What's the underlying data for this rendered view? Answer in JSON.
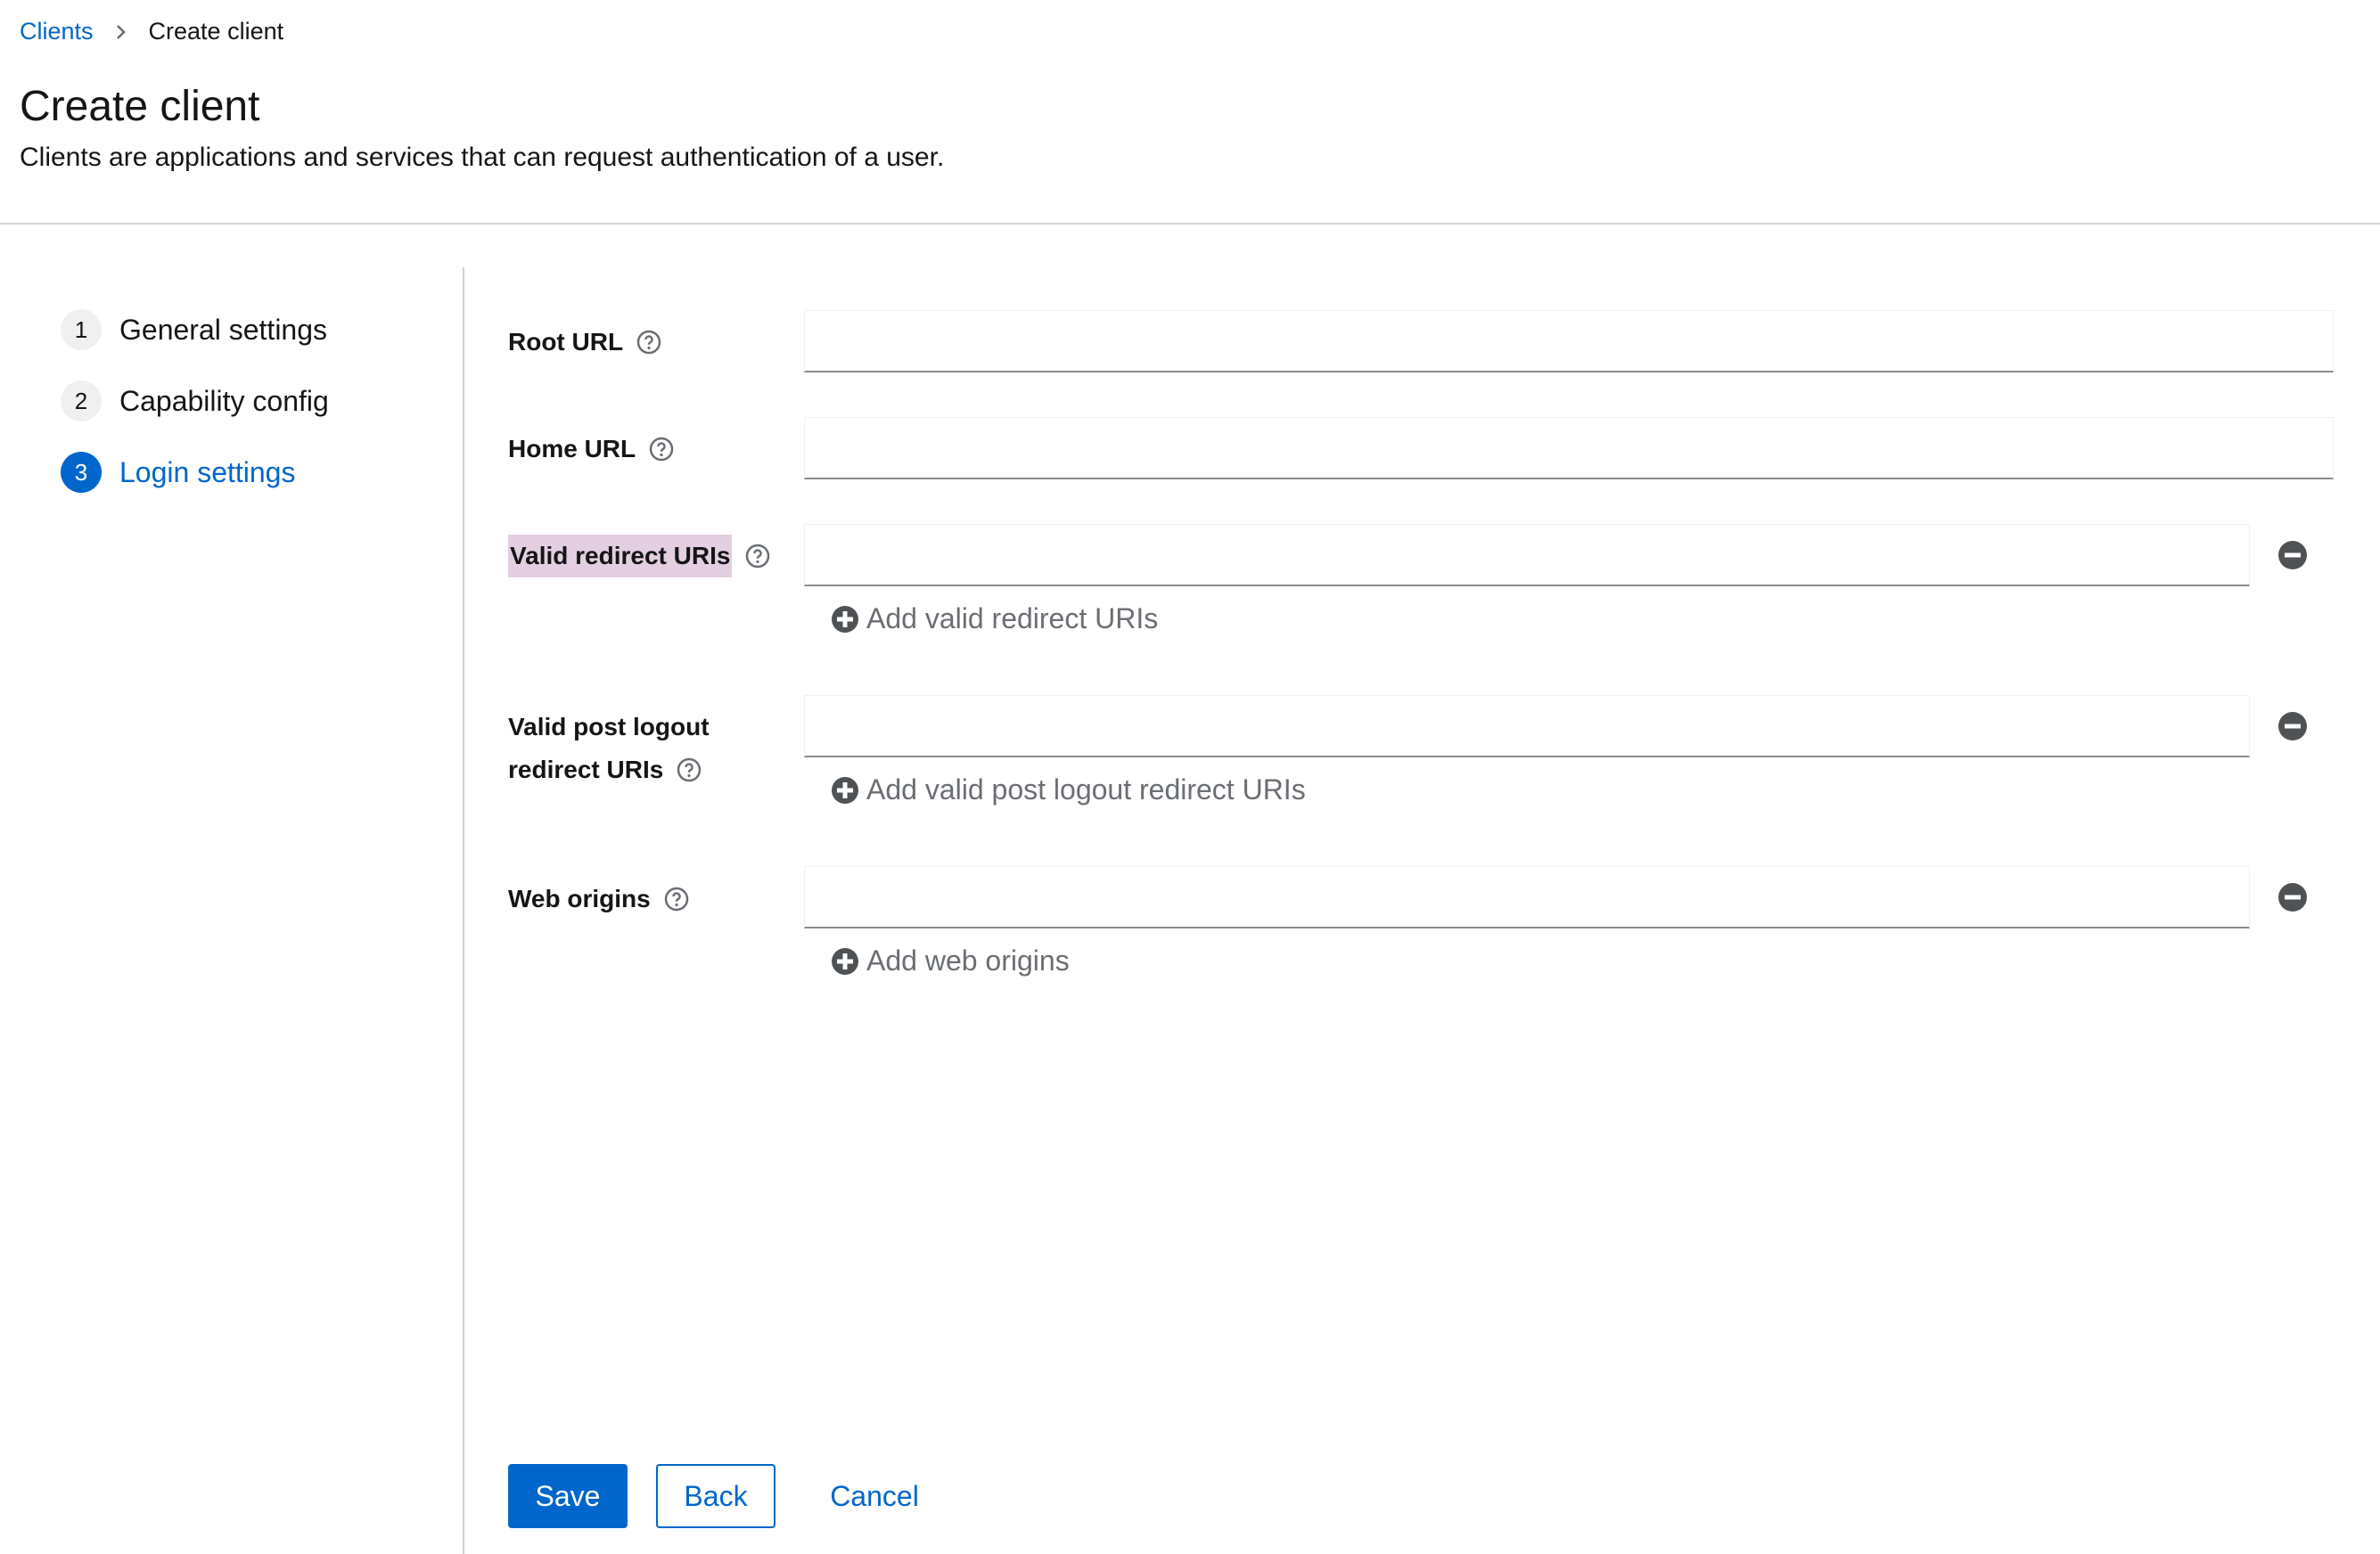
{
  "breadcrumb": {
    "parent": "Clients",
    "current": "Create client"
  },
  "header": {
    "title": "Create client",
    "description": "Clients are applications and services that can request authentication of a user."
  },
  "wizard": {
    "steps": [
      {
        "number": "1",
        "label": "General settings"
      },
      {
        "number": "2",
        "label": "Capability config"
      },
      {
        "number": "3",
        "label": "Login settings"
      }
    ],
    "current_step": 3
  },
  "form": {
    "root_url": {
      "label": "Root URL",
      "value": ""
    },
    "home_url": {
      "label": "Home URL",
      "value": ""
    },
    "valid_redirect_uris": {
      "label": "Valid redirect URIs",
      "value": "",
      "add_label": "Add valid redirect URIs"
    },
    "valid_post_logout_redirect_uris": {
      "label_line1": "Valid post logout",
      "label_line2": "redirect URIs",
      "value": "",
      "add_label": "Add valid post logout redirect URIs"
    },
    "web_origins": {
      "label": "Web origins",
      "value": "",
      "add_label": "Add web origins"
    }
  },
  "actions": {
    "save": "Save",
    "back": "Back",
    "cancel": "Cancel"
  },
  "colors": {
    "primary": "#0066cc",
    "highlight": "#e3cfe1",
    "border": "#d2d2d2",
    "muted": "#6a6e73"
  },
  "icons": {
    "help": "help-circle-icon",
    "remove": "minus-circle-icon",
    "add": "plus-circle-icon",
    "separator": "chevron-right-icon"
  }
}
